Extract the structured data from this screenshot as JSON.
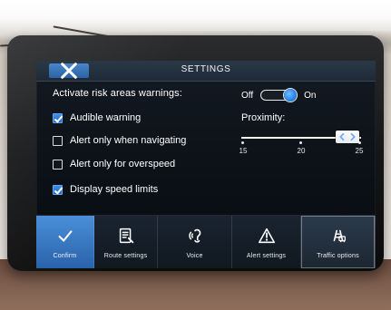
{
  "header": {
    "title": "SETTINGS"
  },
  "risk_areas": {
    "label": "Activate risk areas warnings:",
    "toggle": {
      "off_label": "Off",
      "on_label": "On",
      "state": "on"
    }
  },
  "options": [
    {
      "label": "Audible warning",
      "checked": true
    },
    {
      "label": "Alert only when navigating",
      "checked": false
    },
    {
      "label": "Alert only for overspeed",
      "checked": false
    },
    {
      "label": "Display speed limits",
      "checked": true
    }
  ],
  "proximity": {
    "label": "Proximity:",
    "ticks": [
      "15",
      "20",
      "25"
    ],
    "selected": "25"
  },
  "bottom_tabs": [
    {
      "label": "Confirm",
      "icon": "check-icon",
      "state": "active"
    },
    {
      "label": "Route settings",
      "icon": "route-settings-icon",
      "state": "normal"
    },
    {
      "label": "Voice",
      "icon": "voice-icon",
      "state": "normal"
    },
    {
      "label": "Alert settings",
      "icon": "warning-icon",
      "state": "plain"
    },
    {
      "label": "Traffic options",
      "icon": "traffic-icon",
      "state": "outlined"
    }
  ],
  "colors": {
    "accent": "#2a67c5",
    "screen_bg": "#0b1016",
    "text": "#ffffff"
  }
}
